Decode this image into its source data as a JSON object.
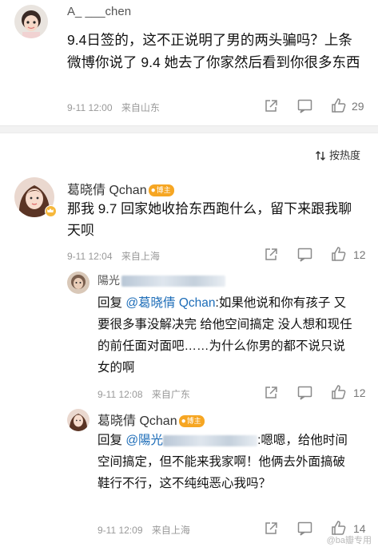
{
  "first_comment": {
    "username": "A_ ___chen",
    "text": "9.4日签的，这不正说明了男的两头骗吗？上条微博你说了 9.4 她去了你家然后看到你很多东西",
    "time": "9-11 12:00",
    "source": "来自山东",
    "likes": "29"
  },
  "sort": {
    "label": "按热度"
  },
  "comment": {
    "username": "葛晓倩 Qchan",
    "badge": "博主",
    "text": "那我 9.7 回家她收拾东西跑什么，留下来跟我聊天呗",
    "time": "9-11 12:04",
    "source": "来自上海",
    "likes": "12"
  },
  "replies": [
    {
      "username": "陽光",
      "prefix": "回复 ",
      "mention": "@葛晓倩 Qchan",
      "text": ":如果他说和你有孩子 又要很多事没解决完 给他空间搞定 没人想和现任的前任面对面吧……为什么你男的都不说只说女的啊",
      "time": "9-11 12:08",
      "source": "来自广东",
      "likes": "12"
    },
    {
      "username": "葛晓倩 Qchan",
      "badge": "博主",
      "prefix": "回复 ",
      "mention": "@陽光",
      "text": ":嗯嗯，给他时间空间搞定，但不能来我家啊！他俩去外面搞破鞋行不行，这不纯纯恶心我吗？",
      "time": "9-11 12:09",
      "source": "来自上海",
      "likes": "14"
    }
  ],
  "watermark": "@ba瓣专用",
  "icons": [
    "avatar-girl",
    "share-icon",
    "comment-icon",
    "like-icon",
    "sort-icon",
    "vip-crown-icon"
  ],
  "colors": {
    "link": "#1d6db8",
    "badge": "#f6a623",
    "meta": "#999999"
  }
}
